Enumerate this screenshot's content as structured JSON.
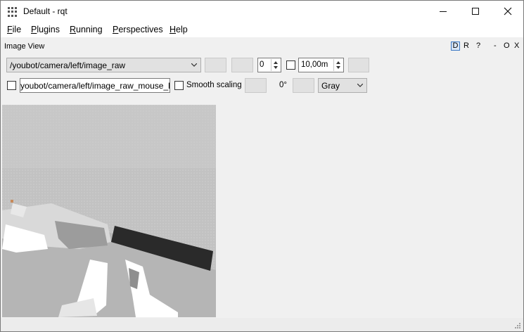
{
  "window": {
    "title": "Default - rqt",
    "minimize_label": "—",
    "maximize_label": "□",
    "close_label": "✕"
  },
  "menu": [
    {
      "label": "File"
    },
    {
      "label": "Plugins"
    },
    {
      "label": "Running"
    },
    {
      "label": "Perspectives"
    },
    {
      "label": "Help"
    }
  ],
  "dock": {
    "title": "Image View",
    "controls": [
      "D",
      "R",
      "?",
      "-",
      "O",
      "X"
    ]
  },
  "toolbar": {
    "topic_value": "/youbot/camera/left/image_raw",
    "spin_value": "0",
    "range_value": "10,00m",
    "mouse_topic_value": "youbot/camera/left/image_raw_mouse_left",
    "smooth_scaling_label": "Smooth scaling",
    "rotation_label": "0°",
    "color_scheme_value": "Gray"
  },
  "colors": {
    "dock_active": "#3b78c4",
    "background": "#f0f0f0",
    "image_background": "#c4c4c4"
  }
}
